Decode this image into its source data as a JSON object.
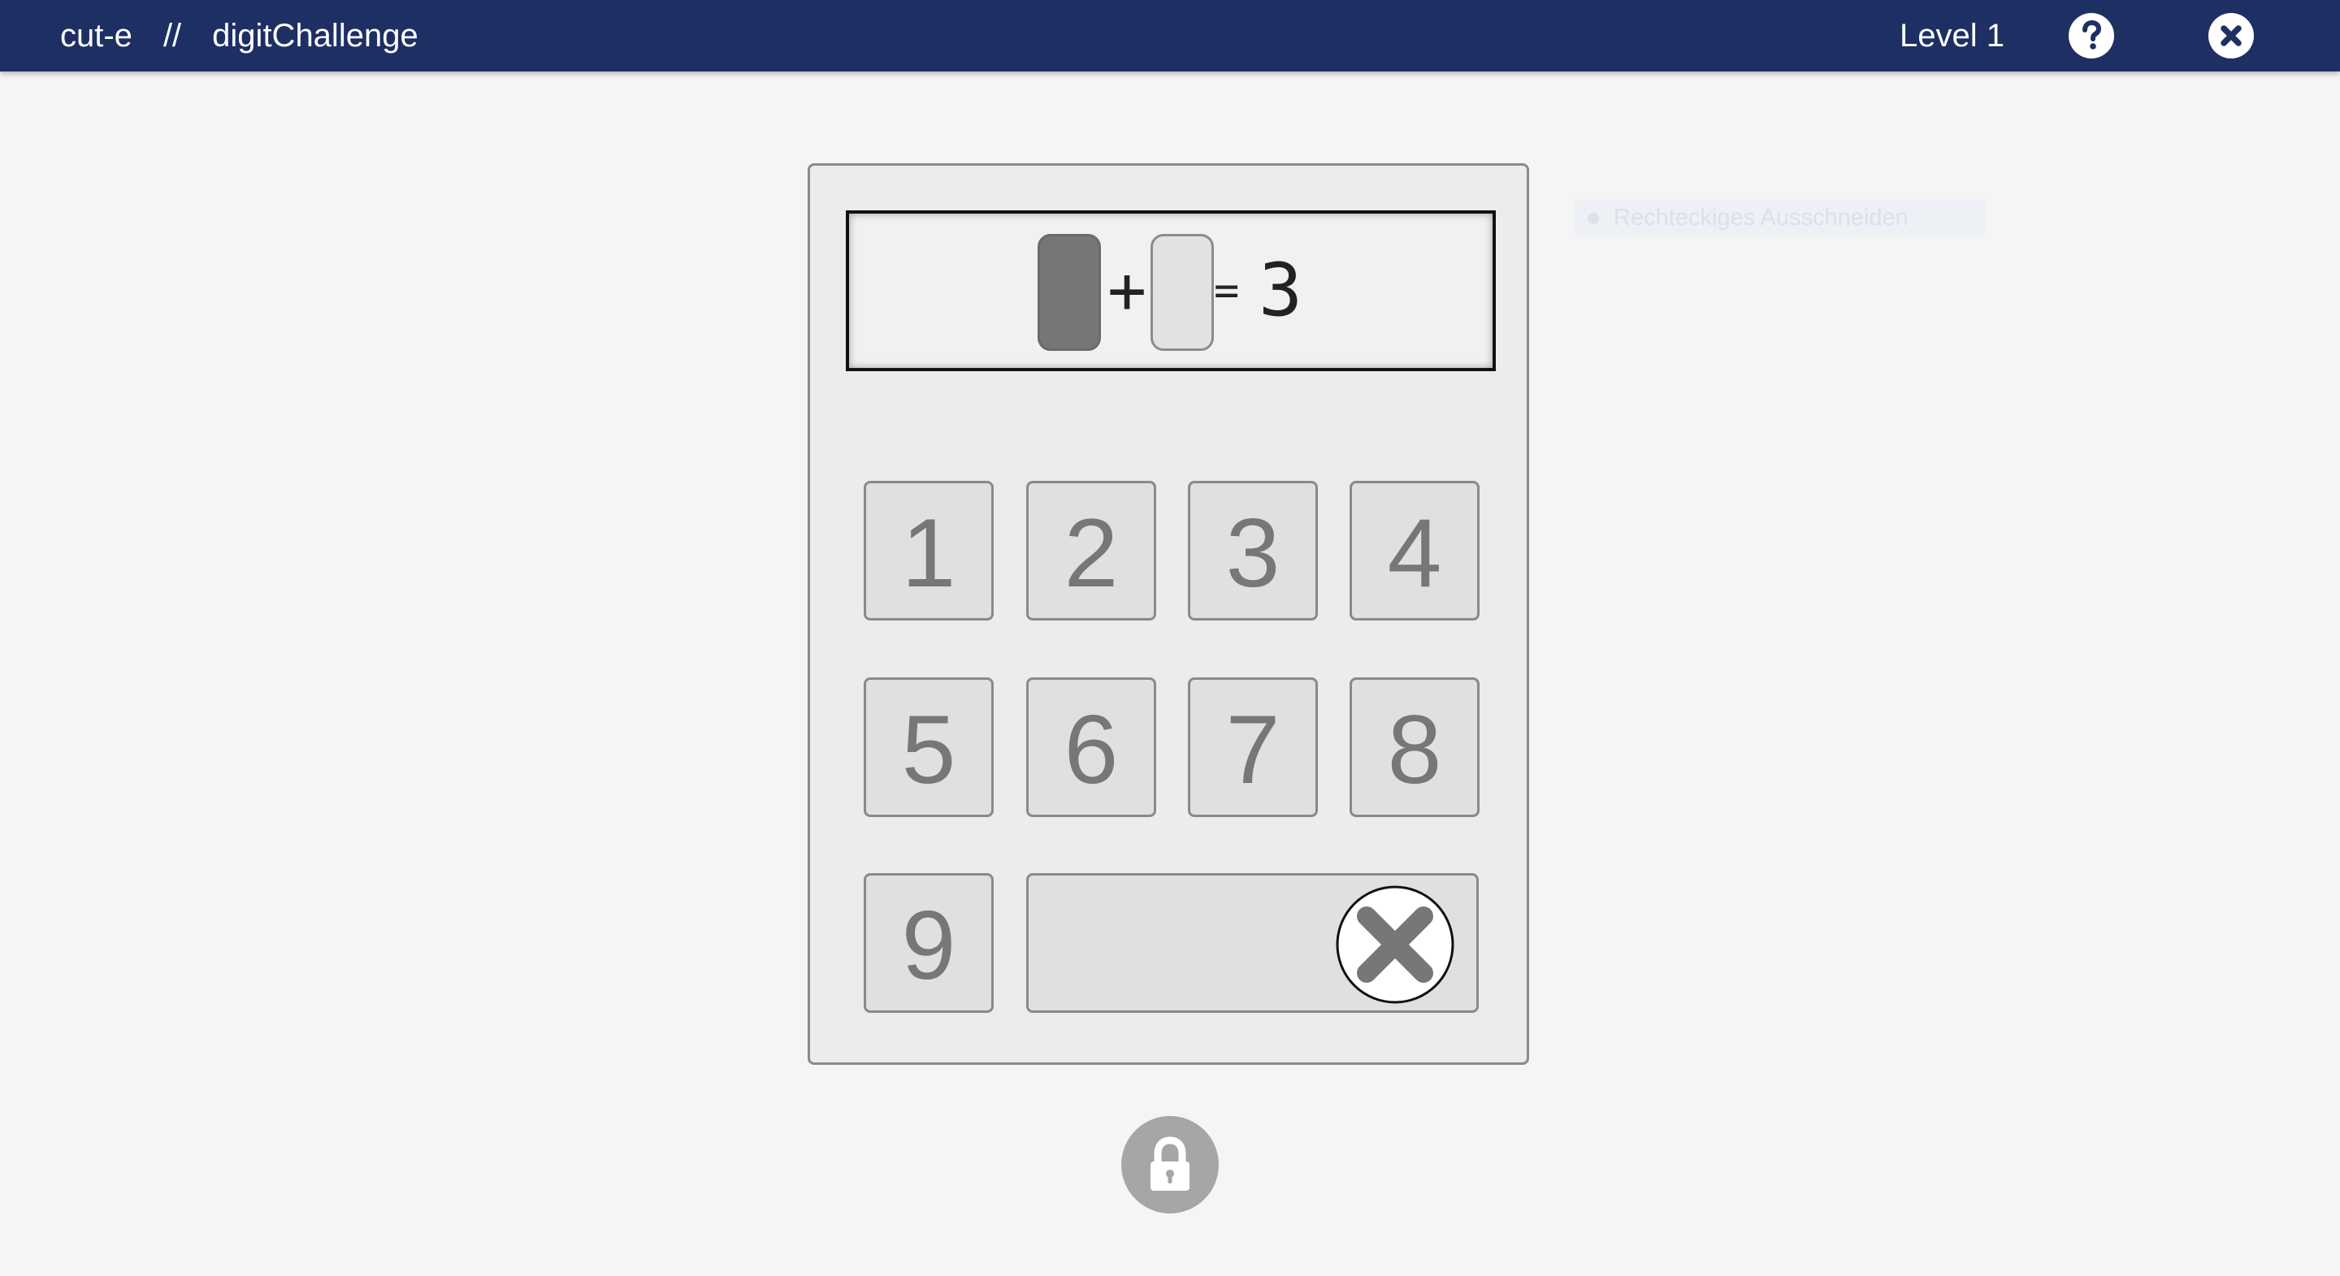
{
  "header": {
    "brand": "cut-e",
    "separator": "//",
    "app_name": "digitChallenge",
    "level_label": "Level 1",
    "help_icon": "question-circle-icon",
    "close_icon": "close-circle-icon"
  },
  "display": {
    "operator": "+",
    "equals": "=",
    "result": "3",
    "slot_a_state": "active",
    "slot_b_state": "empty"
  },
  "keypad": {
    "keys": [
      "1",
      "2",
      "3",
      "4",
      "5",
      "6",
      "7",
      "8",
      "9"
    ],
    "delete_icon": "delete-x-icon"
  },
  "lock_button": {
    "icon": "lock-icon"
  },
  "overlay": {
    "label": "Rechteckiges Ausschneiden"
  },
  "colors": {
    "header_bg": "#1e2f63",
    "page_bg": "#f5f5f5",
    "active_slot": "#767676",
    "key_text": "#777777",
    "lock_bg": "#a6a6a6"
  }
}
